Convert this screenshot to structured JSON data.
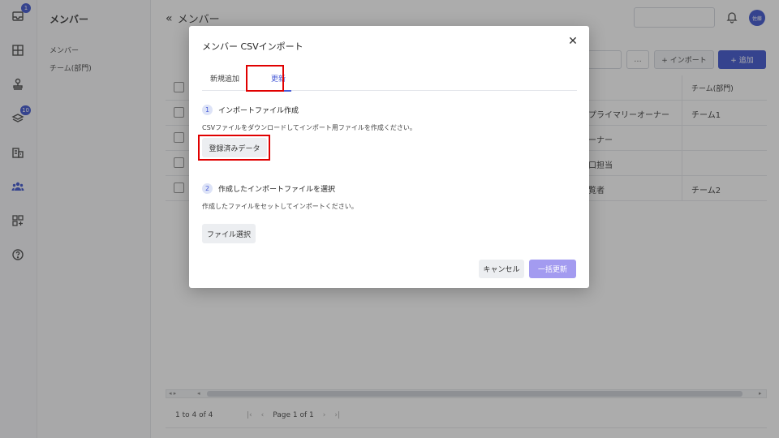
{
  "rail": {
    "inbox_badge": "1",
    "layers_badge": "10"
  },
  "subnav": {
    "title": "メンバー",
    "items": [
      {
        "label": "メンバー"
      },
      {
        "label": "チーム(部門)"
      }
    ]
  },
  "header": {
    "title": "メンバー",
    "avatar_initials": "佐藤"
  },
  "toolbar": {
    "dots_label": "...",
    "import_label": "+ インポート",
    "add_label": "+ 追加"
  },
  "table": {
    "header": {
      "team": "チーム(部門)"
    },
    "rows": [
      {
        "role_partial": "プライマリーオーナー",
        "team": "チーム1"
      },
      {
        "role_partial": "ーナー",
        "team": ""
      },
      {
        "role_partial": "口担当",
        "team": ""
      },
      {
        "role_partial": "覧者",
        "team": "チーム2"
      }
    ]
  },
  "footer": {
    "range": "1 to 4 of 4",
    "page_text": "Page 1 of 1"
  },
  "modal": {
    "title": "メンバー CSVインポート",
    "tabs": [
      {
        "label": "新規追加"
      },
      {
        "label": "更新"
      }
    ],
    "step1": {
      "num": "1",
      "title": "インポートファイル作成",
      "desc": "CSVファイルをダウンロードしてインポート用ファイルを作成ください。",
      "button": "登録済みデータ"
    },
    "step2": {
      "num": "2",
      "title": "作成したインポートファイルを選択",
      "desc": "作成したファイルをセットしてインポートください。",
      "button": "ファイル選択"
    },
    "cancel_label": "キャンセル",
    "submit_label": "一括更新"
  },
  "colors": {
    "accent": "#2740c9",
    "tab_active": "#4b5ed7",
    "submit_disabled": "#a39bf0",
    "highlight": "#e00000"
  }
}
